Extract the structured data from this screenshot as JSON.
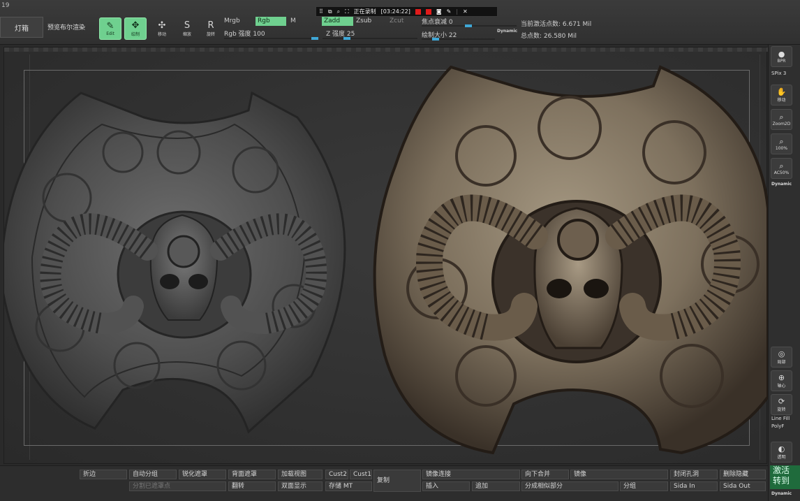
{
  "app": {
    "version_fragment": "19"
  },
  "top_left": {
    "lightbox": "灯箱",
    "bpr": "预览布尔渲染"
  },
  "tools": [
    {
      "label": "Edit",
      "active": true,
      "glyph": "✎"
    },
    {
      "label": "绘制",
      "active": true,
      "glyph": "✥"
    },
    {
      "label": "移动",
      "active": false,
      "glyph": "✣"
    },
    {
      "label": "缩放",
      "active": false,
      "glyph": "S"
    },
    {
      "label": "旋转",
      "active": false,
      "glyph": "R"
    }
  ],
  "brush": {
    "mrgb": "Mrgb",
    "rgb": "Rgb",
    "m": "M",
    "rgb_intensity": "Rgb 强度 100",
    "zadd": "Zadd",
    "zsub": "Zsub",
    "zcut": "Zcut",
    "z_intensity": "Z 强度 25",
    "focal": "焦点衰减 0",
    "draw_size": "绘制大小 22",
    "dynamic": "Dynamic"
  },
  "stats": {
    "active_points": "当前激活点数: 6.671 Mil",
    "total_points": "总点数: 26.580 Mil"
  },
  "recording": {
    "label": "正在录制",
    "time": "[03:24:22]"
  },
  "right_tray": {
    "bpr": "BPR",
    "spix": "SPix 3",
    "move": "移动",
    "zoom2d": "Zoom2D",
    "pct100": "100%",
    "ac50": "AC50%",
    "dynamic_top": "Dynamic",
    "local": "局部",
    "pivot": "轴心",
    "xyz": "旋转",
    "line_fill": "Line Fill",
    "polyf": "PolyF",
    "transp": "透明",
    "dynamic_bottom": "Dynamic",
    "activate": "激活\n转到"
  },
  "bottom": {
    "b1": "折边",
    "b2": "自动分组",
    "b3": "锐化遮罩",
    "b4": "背面遮罩",
    "b5": "加载视图",
    "b6": "Cust2",
    "b7": "Cust1",
    "b8": "复制",
    "b9": "镜像连接",
    "b10": "向下合并",
    "b11": "镜像",
    "b12": "封闭孔洞",
    "b13": "删除隐藏",
    "c1": "分割已遮罩点",
    "c2": "翻转",
    "c3": "双面显示",
    "c4": "存储 MT",
    "c5": "插入",
    "c6": "追加",
    "c7": "分成相似部分",
    "c8": "分组",
    "c9": "Sida In",
    "c10": "Sida Out"
  }
}
